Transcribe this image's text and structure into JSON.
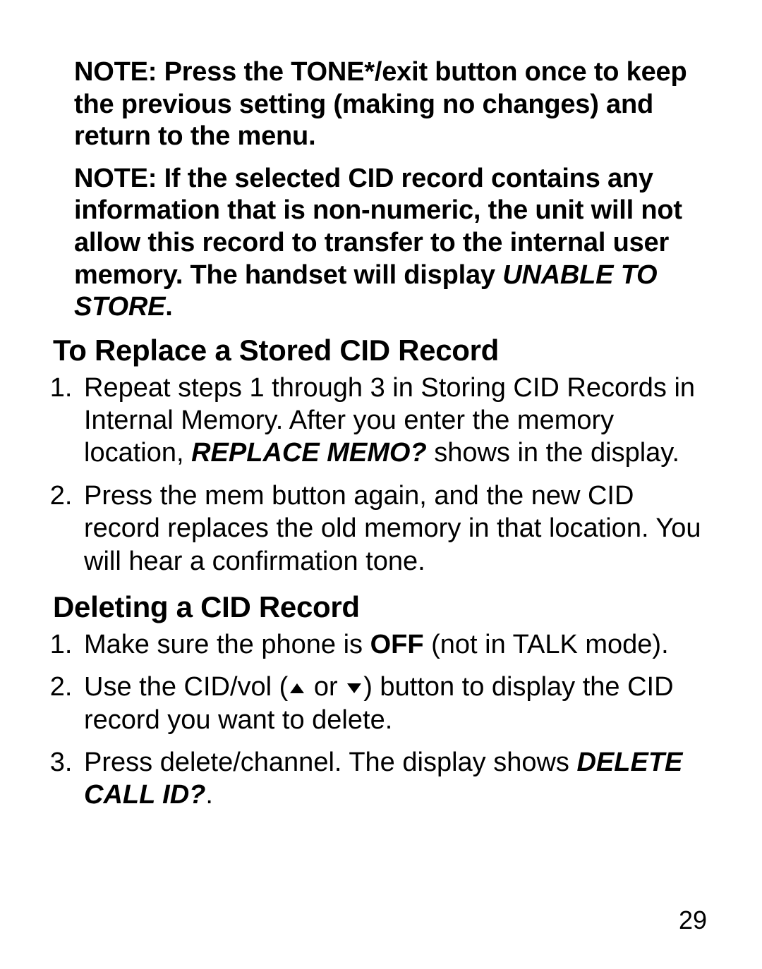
{
  "notes": {
    "note1": "NOTE: Press the TONE*/exit button once to keep the previous setting (making no changes) and return to the menu.",
    "note2_prefix": "NOTE: If the selected CID record contains any information that is non-numeric, the unit will not allow this record to transfer to the internal user memory. The handset will display ",
    "note2_italic": "UNABLE TO STORE",
    "note2_suffix": "."
  },
  "sections": {
    "replace_heading": "To Replace a Stored CID Record",
    "replace_steps": {
      "s1_a": "Repeat steps 1 through 3 in Storing CID Records in Internal Memory. After you enter the memory location, ",
      "s1_b": "REPLACE MEMO?",
      "s1_c": " shows in the display.",
      "s2": "Press the mem button again, and the new CID record replaces the old memory in that location. You will hear a confirmation tone."
    },
    "delete_heading": "Deleting a CID Record",
    "delete_steps": {
      "s1_a": "Make sure the phone is ",
      "s1_b": "OFF",
      "s1_c": " (not in TALK mode).",
      "s2_a": "Use the CID/vol (",
      "s2_or": " or ",
      "s2_b": ") button to display the CID record you want to delete.",
      "s3_a": "Press delete/channel. The display shows ",
      "s3_b": "DELETE CALL ID?",
      "s3_c": "."
    }
  },
  "page_number": "29"
}
